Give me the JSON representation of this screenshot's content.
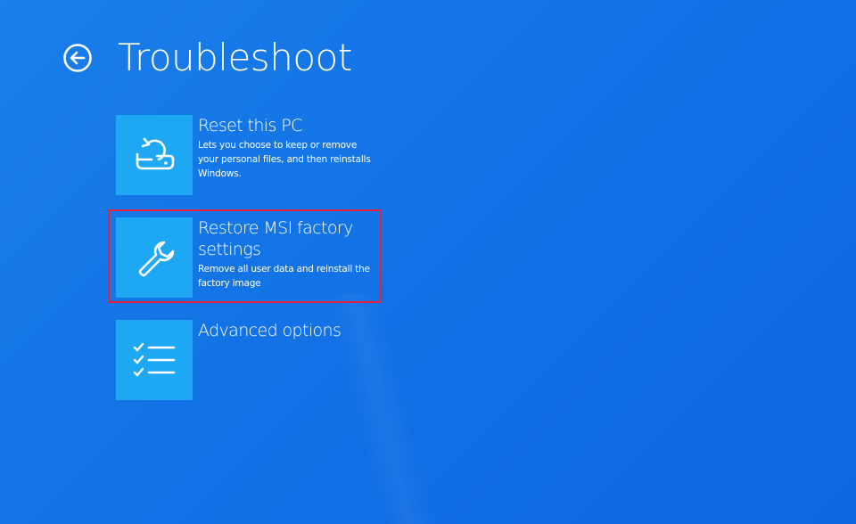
{
  "page": {
    "title": "Troubleshoot",
    "back_icon": "back-arrow-icon"
  },
  "options": [
    {
      "title": "Reset this PC",
      "description": "Lets you choose to keep or remove your personal files, and then reinstalls Windows.",
      "icon": "reset-pc-icon"
    },
    {
      "title": "Restore MSI factory settings",
      "description": "Remove all user data and reinstall the factory image",
      "icon": "wrench-icon"
    },
    {
      "title": "Advanced options",
      "description": "",
      "icon": "checklist-icon"
    }
  ],
  "colors": {
    "background": "#1272e6",
    "tile": "#1ea7f3",
    "highlight": "#e5203a",
    "text": "#ffffff"
  }
}
